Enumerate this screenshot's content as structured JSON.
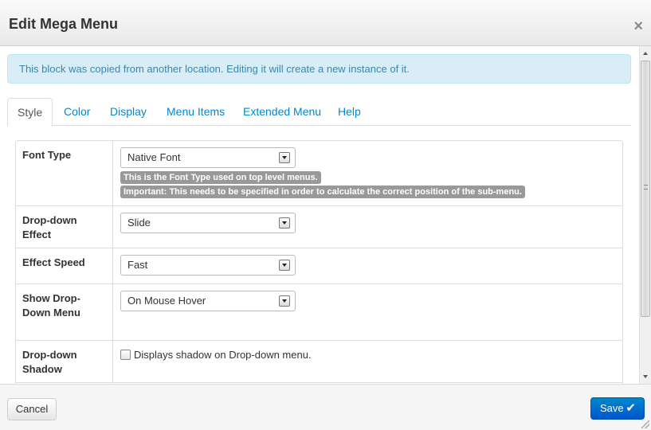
{
  "dialog": {
    "title": "Edit Mega Menu",
    "close_glyph": "×",
    "alert": "This block was copied from another location. Editing it will create a new instance of it."
  },
  "tabs": [
    {
      "label": "Style",
      "active": true
    },
    {
      "label": "Color",
      "active": false
    },
    {
      "label": "Display",
      "active": false
    },
    {
      "label": "Menu Items",
      "active": false
    },
    {
      "label": "Extended Menu",
      "active": false
    },
    {
      "label": "Help",
      "active": false
    }
  ],
  "form": {
    "font_type": {
      "label": "Font Type",
      "value": "Native Font",
      "hint1": "This is the Font Type used on top level menus.",
      "hint2": "Important: This needs to be specified in order to calculate the correct position of the sub-menu."
    },
    "dropdown_effect": {
      "label": "Drop-down Effect",
      "value": "Slide"
    },
    "effect_speed": {
      "label": "Effect Speed",
      "value": "Fast"
    },
    "show_dropdown_menu": {
      "label": "Show Drop-Down Menu",
      "value": "On Mouse Hover"
    },
    "dropdown_shadow": {
      "label": "Drop-down Shadow",
      "checkbox_label": "Displays shadow on Drop-down menu.",
      "checked": false
    }
  },
  "footer": {
    "cancel_label": "Cancel",
    "save_label": "Save",
    "save_icon": "✔"
  },
  "colors": {
    "link": "#0088cc",
    "alert_bg": "#d9edf7",
    "alert_text": "#3a87ad",
    "save_button": "#0066cc",
    "hint_bg": "#999999"
  }
}
